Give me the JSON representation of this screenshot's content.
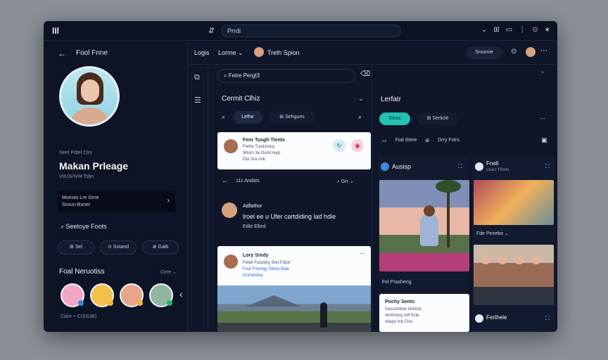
{
  "topbar": {
    "logo": "lIl",
    "nav_icon": "⇵",
    "url": "Prrdi",
    "tools": [
      "⌄",
      "⊞",
      "▭",
      "⋮",
      "⊙",
      "∗"
    ]
  },
  "subheader": {
    "tab_a": "Logis",
    "tab_b": "Lorme ⌄",
    "user_name": "Trelh Spion",
    "button": "Snoonie",
    "more": "⋯"
  },
  "profile": {
    "header": "Fool Fnne",
    "meta": "Seet Pdtel Clrs",
    "name": "Makan Prleage",
    "subtitle": "VIIUS/IVM Tsbn",
    "info_line1": "Murrois Lre Gme",
    "info_line2": "Snsun Buner",
    "search_label": "Seetoye Foots",
    "pills": [
      "⊞ Sel",
      "⊙ Sotand",
      "⊗ Gaib"
    ],
    "section_title": "Foal Neruotiss",
    "section_link": "Cere ⌄",
    "footer_meta": "Ciiire + CISS3B)"
  },
  "bottom_nav": [
    "⌂",
    "●",
    "▭",
    "◱",
    "♙"
  ],
  "feed": {
    "search_placeholder": "Fetre Pergt3",
    "title": "Cermit Clhiz",
    "tab_one": "Lefhe",
    "tab_two": "⊞ Sehgues",
    "card1": {
      "name": "Fenr Tusgh Tients",
      "line1": "Ferhe Tusdsicluy",
      "line2": "Wrurs 3e Dumt Ieyp",
      "line3": "Dta Sra rinb"
    },
    "reply_text": "111 Andsts",
    "reply_right": "⌕ Grr ⌄",
    "post2": {
      "name": "Adllathor",
      "text": "lroel ee u Ufer cartdiding lad hdie",
      "meta": "Edle Elbrd"
    },
    "card3": {
      "name": "Lory Sredy",
      "line1": "Felek Futoidsy Stet Fdick",
      "line2": "Feal Fnemgy Stboo Bale",
      "line3": "Gnmdsboy"
    }
  },
  "right_panel": {
    "title": "Lerfatr",
    "teal_tab": "Stirac",
    "tab_two": "⊞ Serlicle",
    "row": [
      "▭",
      "Fod Stere",
      "⊞",
      "Drry Fstrs"
    ],
    "col_a": {
      "header": "Ausisp",
      "caption": "Fel Prasherig",
      "card_name": "Pochy Sents",
      "card_lines": [
        "Sascomtwe Ienticte",
        "sbrtinnivy odf frcle",
        "vtiepe mb Clos"
      ]
    },
    "col_b": {
      "header": "Fnell",
      "header_sub": "Lbac! Fihsts",
      "caption": "Fde Penebo ⌄",
      "footer": "Ferthele"
    }
  },
  "colors": {
    "window_bg": "#0f1629",
    "accent_teal": "#23c3b0",
    "card_bg": "#fbfcfe"
  }
}
